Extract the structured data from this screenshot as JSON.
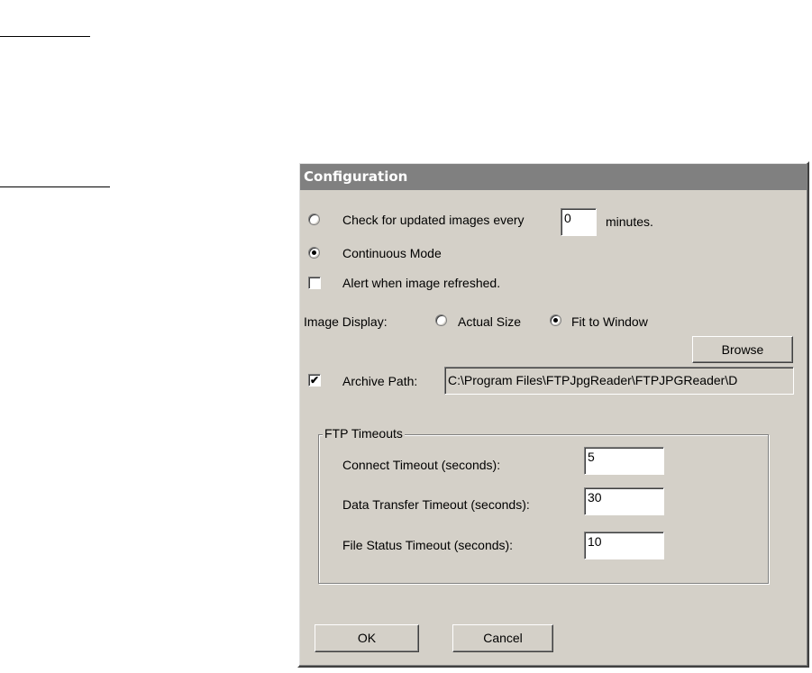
{
  "dialog": {
    "title": "Configuration",
    "check_updates": {
      "label_before": "Check for updated images every",
      "minutes_value": "0",
      "label_after": "minutes.",
      "selected": false
    },
    "continuous_mode": {
      "label": "Continuous Mode",
      "selected": true
    },
    "alert_refresh": {
      "label": "Alert when image refreshed.",
      "checked": false
    },
    "image_display": {
      "label": "Image Display:",
      "options": [
        {
          "label": "Actual Size",
          "selected": false
        },
        {
          "label": "Fit to Window",
          "selected": true
        }
      ]
    },
    "browse_label": "Browse",
    "archive": {
      "label": "Archive Path:",
      "checked": true,
      "path": "C:\\Program Files\\FTPJpgReader\\FTPJPGReader\\D"
    },
    "ftp_timeouts": {
      "title": "FTP Timeouts",
      "connect": {
        "label": "Connect Timeout (seconds):",
        "value": "5"
      },
      "data_transfer": {
        "label": "Data Transfer Timeout (seconds):",
        "value": "30"
      },
      "file_status": {
        "label": "File Status Timeout (seconds):",
        "value": "10"
      }
    },
    "ok_label": "OK",
    "cancel_label": "Cancel"
  }
}
